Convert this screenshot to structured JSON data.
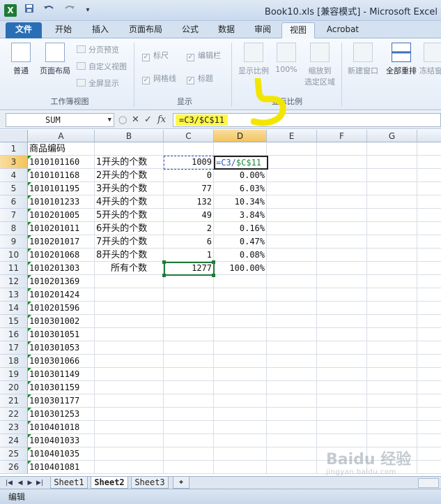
{
  "window": {
    "title": "Book10.xls  [兼容模式] - Microsoft Excel"
  },
  "quick_access": {
    "logo": "X",
    "save_icon": "save-icon",
    "undo_icon": "undo-icon",
    "redo_icon": "redo-icon"
  },
  "tabs": [
    {
      "label": "文件",
      "type": "file"
    },
    {
      "label": "开始"
    },
    {
      "label": "插入"
    },
    {
      "label": "页面布局"
    },
    {
      "label": "公式"
    },
    {
      "label": "数据"
    },
    {
      "label": "审阅"
    },
    {
      "label": "视图",
      "active": true
    },
    {
      "label": "Acrobat"
    }
  ],
  "ribbon": {
    "workbook_views": {
      "label": "工作簿视图",
      "normal": "普通",
      "page_layout": "页面布局",
      "page_break": "分页预览",
      "custom_views": "自定义视图",
      "full_screen": "全屏显示"
    },
    "show": {
      "label": "显示",
      "ruler": "标尺",
      "formula_bar": "编辑栏",
      "gridlines": "网格线",
      "headings": "标题"
    },
    "zoom": {
      "label": "显示比例",
      "zoom": "显示比例",
      "pct100": "100%",
      "zoom_sel_1": "缩放到",
      "zoom_sel_2": "选定区域"
    },
    "window": {
      "new_window": "新建窗口",
      "arrange_all": "全部重排",
      "freeze": "冻结窗"
    }
  },
  "formula_bar": {
    "name_box": "SUM",
    "formula": "=C3/$C$11",
    "cancel": "✕",
    "enter": "✓",
    "fx": "fx"
  },
  "columns": [
    "A",
    "B",
    "C",
    "D",
    "E",
    "F",
    "G"
  ],
  "selected_column": "D",
  "rows": [
    {
      "n": "1",
      "a": "商品编码",
      "b": "",
      "c": "",
      "d": ""
    },
    {
      "n": "3",
      "a": "1010101160",
      "b": "1开头的个数",
      "c": "1009",
      "d": "=C3/$C$11"
    },
    {
      "n": "4",
      "a": "1010101168",
      "b": "2开头的个数",
      "c": "0",
      "d": "0.00%"
    },
    {
      "n": "5",
      "a": "1010101195",
      "b": "3开头的个数",
      "c": "77",
      "d": "6.03%"
    },
    {
      "n": "6",
      "a": "1010101233",
      "b": "4开头的个数",
      "c": "132",
      "d": "10.34%"
    },
    {
      "n": "7",
      "a": "1010201005",
      "b": "5开头的个数",
      "c": "49",
      "d": "3.84%"
    },
    {
      "n": "8",
      "a": "1010201011",
      "b": "6开头的个数",
      "c": "2",
      "d": "0.16%"
    },
    {
      "n": "9",
      "a": "1010201017",
      "b": "7开头的个数",
      "c": "6",
      "d": "0.47%"
    },
    {
      "n": "10",
      "a": "1010201068",
      "b": "8开头的个数",
      "c": "1",
      "d": "0.08%"
    },
    {
      "n": "11",
      "a": "1010201303",
      "b": "所有个数",
      "c": "1277",
      "d": "100.00%"
    },
    {
      "n": "12",
      "a": "1010201369",
      "b": "",
      "c": "",
      "d": ""
    },
    {
      "n": "13",
      "a": "1010201424",
      "b": "",
      "c": "",
      "d": ""
    },
    {
      "n": "14",
      "a": "1010201596",
      "b": "",
      "c": "",
      "d": ""
    },
    {
      "n": "15",
      "a": "1010301002",
      "b": "",
      "c": "",
      "d": ""
    },
    {
      "n": "16",
      "a": "1010301051",
      "b": "",
      "c": "",
      "d": ""
    },
    {
      "n": "17",
      "a": "1010301053",
      "b": "",
      "c": "",
      "d": ""
    },
    {
      "n": "18",
      "a": "1010301066",
      "b": "",
      "c": "",
      "d": ""
    },
    {
      "n": "19",
      "a": "1010301149",
      "b": "",
      "c": "",
      "d": ""
    },
    {
      "n": "20",
      "a": "1010301159",
      "b": "",
      "c": "",
      "d": ""
    },
    {
      "n": "21",
      "a": "1010301177",
      "b": "",
      "c": "",
      "d": ""
    },
    {
      "n": "22",
      "a": "1010301253",
      "b": "",
      "c": "",
      "d": ""
    },
    {
      "n": "23",
      "a": "1010401018",
      "b": "",
      "c": "",
      "d": ""
    },
    {
      "n": "24",
      "a": "1010401033",
      "b": "",
      "c": "",
      "d": ""
    },
    {
      "n": "25",
      "a": "1010401035",
      "b": "",
      "c": "",
      "d": ""
    },
    {
      "n": "26",
      "a": "1010401081",
      "b": "",
      "c": "",
      "d": ""
    }
  ],
  "edit_cell": {
    "part1": "=C3/",
    "part2": "$C$11"
  },
  "sheets": [
    {
      "label": "Sheet1"
    },
    {
      "label": "Sheet2",
      "active": true
    },
    {
      "label": "Sheet3"
    }
  ],
  "status": {
    "mode": "编辑"
  },
  "watermark": {
    "main": "Baidu 经验",
    "sub": "jingyan.baidu.com"
  },
  "colors": {
    "accent": "#2a6fb6",
    "highlight": "#fff84a",
    "annotation": "#f2e600",
    "selection": "#1f7a3a"
  }
}
